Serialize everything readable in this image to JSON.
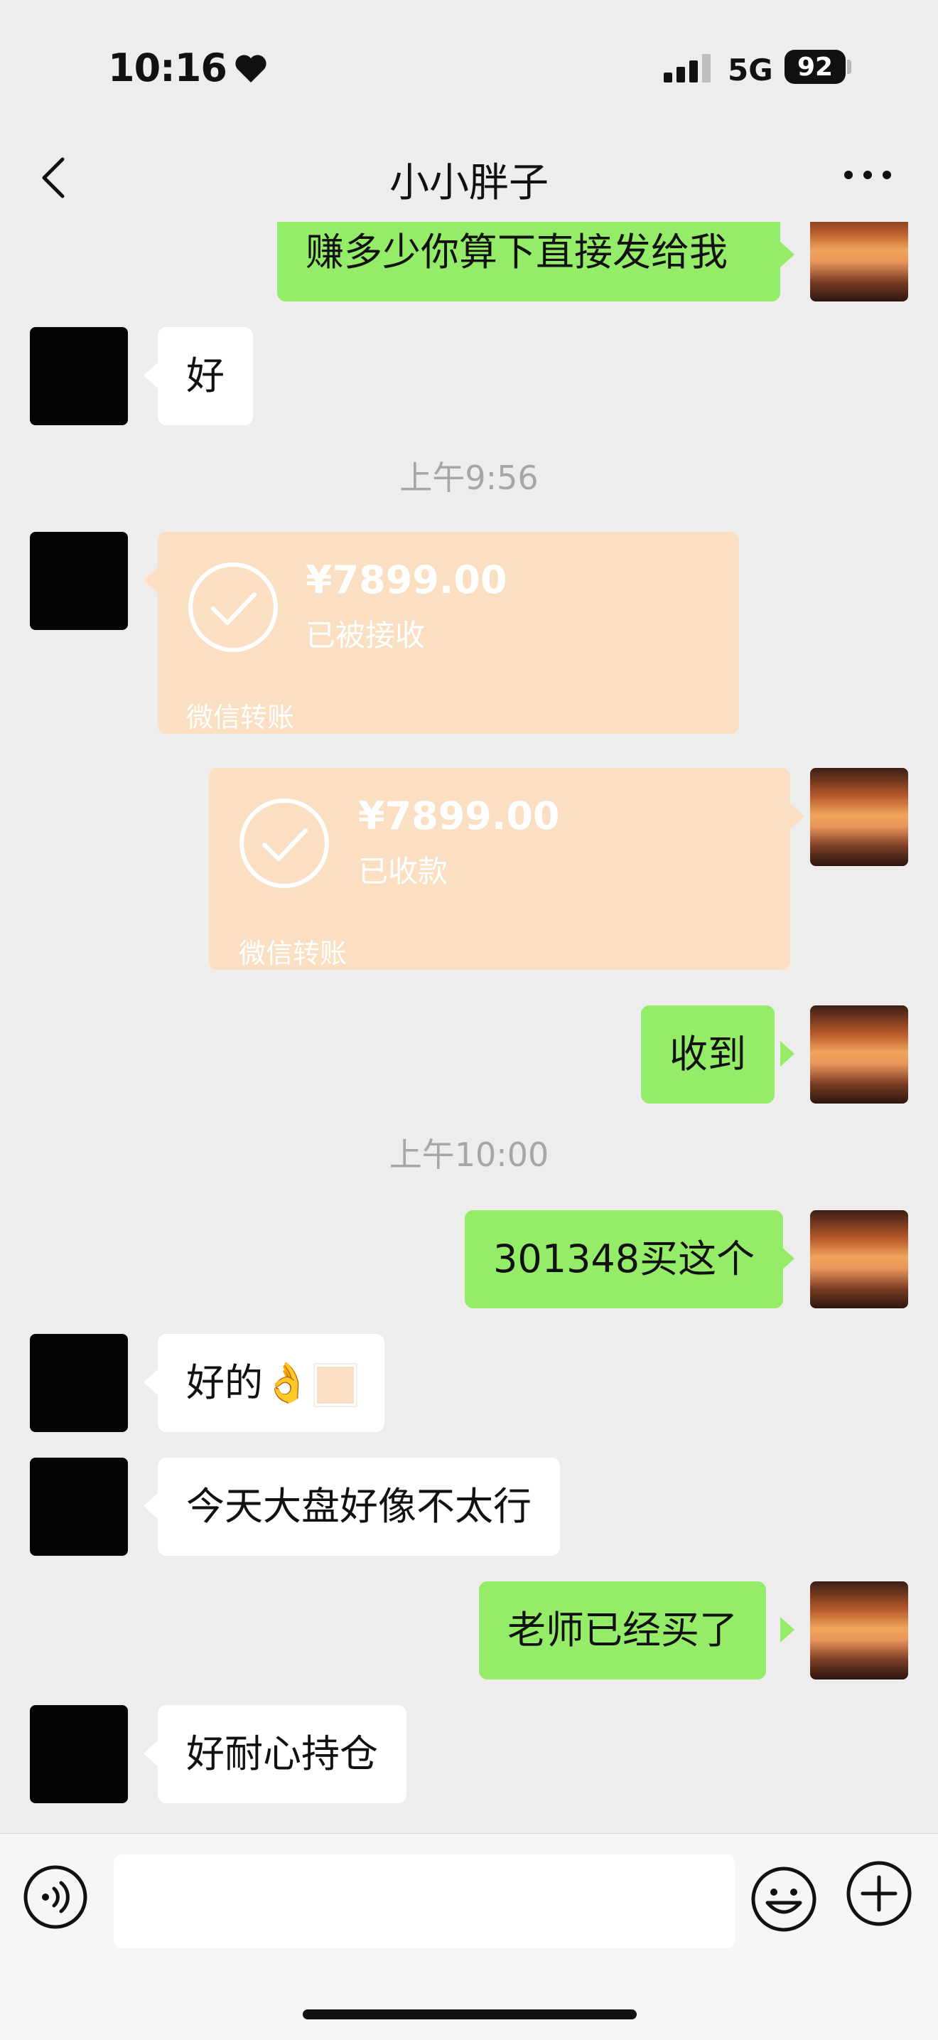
{
  "status_bar": {
    "time": "10:16",
    "network": "5G",
    "battery": "92"
  },
  "header": {
    "title": "小小胖子"
  },
  "messages": {
    "m0": "赚多少你算下直接发给我",
    "m1": "好",
    "ts1": "上午9:56",
    "t1": {
      "amount": "¥7899.00",
      "status": "已被接收",
      "label": "微信转账"
    },
    "t2": {
      "amount": "¥7899.00",
      "status": "已收款",
      "label": "微信转账"
    },
    "m2": "收到",
    "ts2": "上午10:00",
    "m3": "301348买这个",
    "m4": "好的👌",
    "m5": "今天大盘好像不太行",
    "m6": "老师已经买了",
    "m7": "好耐心持仓"
  },
  "colors": {
    "sent_bubble": "#95ec69",
    "received_bubble": "#ffffff",
    "transfer_card": "#fbdfc2",
    "background": "#ededed"
  },
  "icons": [
    "heart-icon",
    "signal-icon",
    "back-chevron-icon",
    "more-icon",
    "check-circle-icon",
    "voice-icon",
    "emoji-icon",
    "plus-icon"
  ]
}
